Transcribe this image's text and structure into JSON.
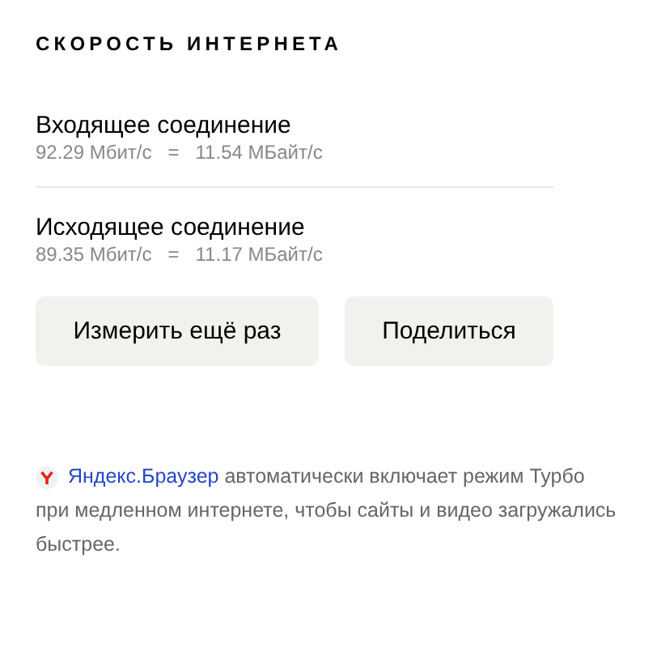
{
  "title": "СКОРОСТЬ ИНТЕРНЕТА",
  "connections": [
    {
      "name": "Входящее соединение",
      "reading": "92.29 Мбит/с   =   11.54 МБайт/с"
    },
    {
      "name": "Исходящее соединение",
      "reading": "89.35 Мбит/с   =   11.17 МБайт/с"
    }
  ],
  "buttons": [
    "Измерить ещё раз",
    "Поделиться"
  ],
  "note": {
    "link": "Яндекс.Браузер",
    "first_line": " автоматически включает режим Турбо",
    "rest": "при медленном интернете, чтобы сайты и видео загружались быстрее."
  }
}
